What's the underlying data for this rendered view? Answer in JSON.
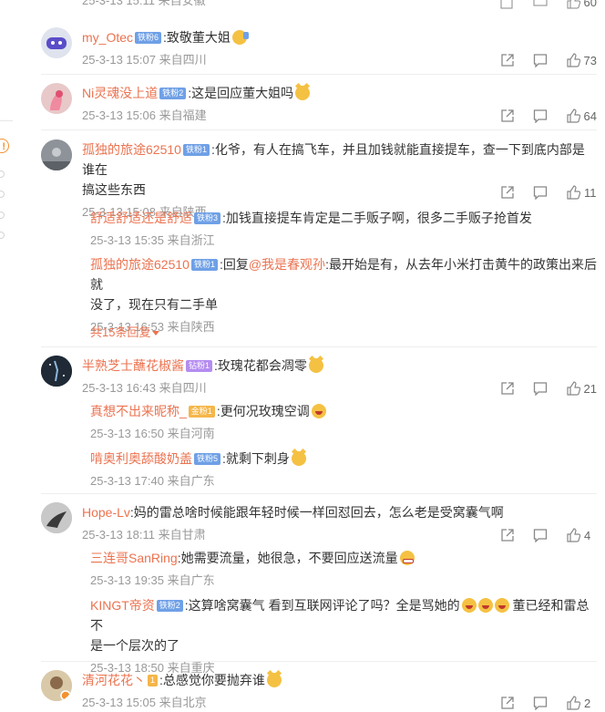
{
  "top_partial": {
    "text": "25-3-13 15:11 来自安徽",
    "likes": "60"
  },
  "comments": [
    {
      "name": "my_Otec",
      "badge": "铁粉6",
      "text": ":致敬董大姐",
      "emoji": "salute",
      "time": "25-3-13 15:07",
      "location": "来自四川",
      "likes": "73"
    },
    {
      "name": "Ni灵魂没上道",
      "badge": "铁粉2",
      "text": ":这是回应董大姐吗",
      "emoji": "cat",
      "time": "25-3-13 15:06",
      "location": "来自福建",
      "likes": "64"
    },
    {
      "name": "孤独的旅途62510",
      "badge": "铁粉1",
      "text_line1": ":化爷，有人在搞飞车，并且加钱就能直接提车，查一下到底内部是谁在",
      "text_line2": "搞这些东西",
      "time": "25-3-13 15:08",
      "location": "来自陕西",
      "likes": "11"
    },
    {
      "name": "半熟芝士蘸花椒酱",
      "badge": "钻粉1",
      "text": ":玫瑰花都会凋零",
      "emoji": "cat",
      "time": "25-3-13 16:43",
      "location": "来自四川",
      "likes": "21"
    },
    {
      "name": "Hope-Lv",
      "text": ":妈的雷总啥时候能跟年轻时候一样回怼回去，怎么老是受窝囊气啊",
      "time": "25-3-13 18:11",
      "location": "来自甘肃",
      "likes": "4"
    },
    {
      "name": "清河花花丶",
      "badge": "1",
      "text": ":总感觉你要抛弃谁",
      "emoji": "cat",
      "time": "25-3-13 15:05",
      "location": "来自北京",
      "likes": "2"
    }
  ],
  "replies_c3": [
    {
      "name": "舒适舒适还是舒适",
      "badge": "铁粉3",
      "text": ":加钱直接提车肯定是二手贩子啊，很多二手贩子抢首发",
      "time": "25-3-13 15:35",
      "location": "来自浙江"
    },
    {
      "name": "孤独的旅途62510",
      "badge": "铁粉1",
      "text_pre": ":回复",
      "mention": "@我是春观孙",
      "text_line1": ":最开始是有，从去年小米打击黄牛的政策出来后就",
      "text_line2": "没了，现在只有二手单",
      "time": "25-3-13 16:53",
      "location": "来自陕西"
    }
  ],
  "more_replies": "共15条回复",
  "replies_c4": [
    {
      "name": "真想不出来昵称_",
      "badge": "金粉1",
      "text": ":更何况玫瑰空调",
      "emoji": "laugh",
      "time": "25-3-13 16:50",
      "location": "来自河南"
    },
    {
      "name": "啃奥利奥舔酸奶盖",
      "badge": "铁粉5",
      "text": ":就剩下刺身",
      "emoji": "cat",
      "time": "25-3-13 17:40",
      "location": "来自广东"
    }
  ],
  "replies_c5": [
    {
      "name": "三连哥SanRing",
      "text": ":她需要流量，她很急，不要回应送流量",
      "emoji": "grin",
      "time": "25-3-13 19:35",
      "location": "来自广东"
    },
    {
      "name": "KINGT帝资",
      "badge": "铁粉2",
      "text_line1": ":这算啥窝囊气 看到互联网评论了吗？全是骂她的",
      "text_mid": " 董已经和雷总不",
      "text_line2": "是一个层次的了",
      "time": "25-3-13 18:50",
      "location": "来自重庆"
    }
  ],
  "colors": {
    "name": "#eb7350",
    "meta": "#999999",
    "badge_blue": "#6fa0e6",
    "badge_purple": "#b48cf0"
  },
  "icons": [
    "share-icon",
    "comment-icon",
    "like-icon"
  ]
}
